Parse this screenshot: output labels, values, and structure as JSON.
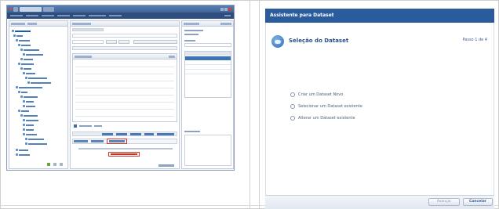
{
  "wizard": {
    "title": "Assistente para Dataset",
    "heading": "Seleção do Dataset",
    "step": "Passo 1 de 4",
    "options": [
      {
        "label": "Criar um Dataset Novo"
      },
      {
        "label": "Selecionar um Dataset existente"
      },
      {
        "label": "Alterar um Dataset existente"
      }
    ],
    "buttons": {
      "next": "Avançar",
      "cancel": "Cancelar"
    }
  },
  "ide": {
    "menu_items": [
      "Arquivo",
      "Editar",
      "Exibir",
      "Projeto",
      "Ferramentas",
      "Janela",
      "Ajuda"
    ],
    "accent": "#2f4e7e",
    "highlight": "#d9322a"
  }
}
